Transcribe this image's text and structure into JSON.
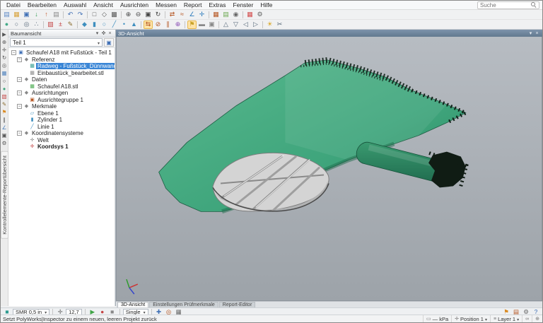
{
  "colors": {
    "selection_blue": "#3a86d6",
    "mesh_green": "#3fa57c",
    "viewport_background": "#a9aeb4",
    "highlight_orange": "#fde3a7"
  },
  "menubar": {
    "items": [
      "Datei",
      "Bearbeiten",
      "Auswahl",
      "Ansicht",
      "Ausrichten",
      "Messen",
      "Report",
      "Extras",
      "Fenster",
      "Hilfe"
    ],
    "search_placeholder": "Suche"
  },
  "toolbars": {
    "row1": [
      {
        "name": "new-project-icon",
        "glyph": "▤",
        "color": "#5b87c5"
      },
      {
        "name": "open-project-icon",
        "glyph": "▦",
        "color": "#d8a23a"
      },
      {
        "name": "save-project-icon",
        "glyph": "▣",
        "color": "#3f6fb5"
      },
      {
        "name": "import-file-icon",
        "glyph": "↓",
        "color": "#2e9b4f"
      },
      {
        "name": "export-file-icon",
        "glyph": "↑",
        "color": "#c55b2e"
      },
      {
        "name": "print-icon",
        "glyph": "▤",
        "color": "#888888"
      },
      {
        "sep": true
      },
      {
        "name": "undo-icon",
        "glyph": "↶",
        "color": "#3f6fb5"
      },
      {
        "name": "redo-icon",
        "glyph": "↷",
        "color": "#3f6fb5"
      },
      {
        "sep": true
      },
      {
        "name": "select-rectangle-icon",
        "glyph": "□",
        "color": "#555555"
      },
      {
        "name": "select-polygon-icon",
        "glyph": "◇",
        "color": "#555555"
      },
      {
        "name": "select-all-icon",
        "glyph": "▩",
        "color": "#555555"
      },
      {
        "sep": true
      },
      {
        "name": "zoom-in-icon",
        "glyph": "⊕",
        "color": "#444444"
      },
      {
        "name": "zoom-out-icon",
        "glyph": "⊖",
        "color": "#444444"
      },
      {
        "name": "fit-view-icon",
        "glyph": "▣",
        "color": "#444444"
      },
      {
        "name": "rotate-view-icon",
        "glyph": "↻",
        "color": "#444444"
      },
      {
        "sep": true
      },
      {
        "name": "align-icon",
        "glyph": "⇄",
        "color": "#b5541f"
      },
      {
        "name": "best-fit-icon",
        "glyph": "≈",
        "color": "#b5541f"
      },
      {
        "name": "measure-icon",
        "glyph": "∠",
        "color": "#2e7dbd"
      },
      {
        "name": "probe-icon",
        "glyph": "✛",
        "color": "#2e7dbd"
      },
      {
        "sep": true
      },
      {
        "name": "report-icon",
        "glyph": "▦",
        "color": "#b5541f"
      },
      {
        "name": "table-icon",
        "glyph": "▤",
        "color": "#6aa84f"
      },
      {
        "name": "snapshot-icon",
        "glyph": "◉",
        "color": "#666666"
      },
      {
        "sep": true
      },
      {
        "name": "grid-icon",
        "glyph": "▦",
        "color": "#d24b4b"
      },
      {
        "name": "options-icon",
        "glyph": "⚙",
        "color": "#666666"
      }
    ],
    "row2": [
      {
        "name": "shaded-view-icon",
        "glyph": "●",
        "color": "#44aa88"
      },
      {
        "name": "wireframe-view-icon",
        "glyph": "○",
        "color": "#556677"
      },
      {
        "name": "surface-view-icon",
        "glyph": "◎",
        "color": "#556677"
      },
      {
        "name": "points-view-icon",
        "glyph": "∴",
        "color": "#556677"
      },
      {
        "sep": true
      },
      {
        "name": "colormap-icon",
        "glyph": "▧",
        "color": "#c44545"
      },
      {
        "name": "deviation-icon",
        "glyph": "±",
        "color": "#c44545"
      },
      {
        "name": "annotation-icon",
        "glyph": "✎",
        "color": "#8a6d2f"
      },
      {
        "sep": true
      },
      {
        "name": "plane-feature-icon",
        "glyph": "◆",
        "color": "#3f8fbf"
      },
      {
        "name": "cylinder-feature-icon",
        "glyph": "▮",
        "color": "#3f8fbf"
      },
      {
        "name": "circle-feature-icon",
        "glyph": "○",
        "color": "#3f8fbf"
      },
      {
        "name": "line-feature-icon",
        "glyph": "╱",
        "color": "#3f8fbf"
      },
      {
        "name": "point-feature-icon",
        "glyph": "•",
        "color": "#3f8fbf"
      },
      {
        "name": "cone-feature-icon",
        "glyph": "▲",
        "color": "#3f8fbf"
      },
      {
        "sep": true
      },
      {
        "name": "compare-icon",
        "glyph": "⇆",
        "color": "#b5541f",
        "active": true
      },
      {
        "name": "cross-section-icon",
        "glyph": "⊘",
        "color": "#b5541f"
      },
      {
        "name": "caliper-icon",
        "glyph": "∥",
        "color": "#b5541f"
      },
      {
        "name": "gdt-icon",
        "glyph": "⊕",
        "color": "#8a4fb5"
      },
      {
        "sep": true
      },
      {
        "name": "flag-icon",
        "glyph": "⚑",
        "color": "#c9a227",
        "active": true
      },
      {
        "name": "note-icon",
        "glyph": "▬",
        "color": "#888888"
      },
      {
        "name": "camera-icon",
        "glyph": "▣",
        "color": "#888888"
      },
      {
        "sep": true
      },
      {
        "name": "view-front-icon",
        "glyph": "△",
        "color": "#556677"
      },
      {
        "name": "view-top-icon",
        "glyph": "▽",
        "color": "#556677"
      },
      {
        "name": "view-left-icon",
        "glyph": "◁",
        "color": "#556677"
      },
      {
        "name": "view-right-icon",
        "glyph": "▷",
        "color": "#556677"
      },
      {
        "sep": true
      },
      {
        "name": "light-icon",
        "glyph": "☀",
        "color": "#d9a520"
      },
      {
        "name": "clip-icon",
        "glyph": "✂",
        "color": "#556677"
      }
    ]
  },
  "side_toolbar": {
    "icons": [
      {
        "name": "select-elements-icon",
        "glyph": "▶",
        "color": "#555555"
      },
      {
        "name": "zoom-icon",
        "glyph": "⊕",
        "color": "#555555"
      },
      {
        "name": "pan-icon",
        "glyph": "✛",
        "color": "#555555"
      },
      {
        "name": "rotate-icon",
        "glyph": "↻",
        "color": "#555555"
      },
      {
        "name": "center-view-icon",
        "glyph": "◎",
        "color": "#555555"
      },
      {
        "name": "standard-views-icon",
        "glyph": "▦",
        "color": "#4a7ebb"
      },
      {
        "name": "wireframe-icon",
        "glyph": "○",
        "color": "#555555"
      },
      {
        "name": "shading-icon",
        "glyph": "●",
        "color": "#3fa57c"
      },
      {
        "name": "colormap-icon",
        "glyph": "▧",
        "color": "#c44545"
      },
      {
        "name": "annotations-icon",
        "glyph": "✎",
        "color": "#8a6d2f"
      },
      {
        "name": "flag-icon",
        "glyph": "⚑",
        "color": "#d9881f"
      },
      {
        "name": "section-icon",
        "glyph": "∥",
        "color": "#555555"
      },
      {
        "name": "measure-icon",
        "glyph": "∠",
        "color": "#4a7ebb"
      },
      {
        "name": "camera-icon",
        "glyph": "▣",
        "color": "#555555"
      },
      {
        "name": "settings-icon",
        "glyph": "⚙",
        "color": "#555555"
      }
    ],
    "vertical_tab": "Kontrollelemente-Reportübersicht"
  },
  "tree": {
    "title": "Baumansicht",
    "header_icons": [
      {
        "name": "caret-down-icon",
        "glyph": "▾"
      },
      {
        "name": "pin-icon",
        "glyph": "✜"
      },
      {
        "name": "close-icon",
        "glyph": "×"
      }
    ],
    "part_selector": "Teil 1",
    "part_button_icon": {
      "name": "part-icon",
      "glyph": "▣",
      "color": "#3f6fb5"
    },
    "items": [
      {
        "label": "Schaufel A18 mit Fußstück - Teil 1",
        "depth": 0,
        "expand": true,
        "icon": "▣",
        "icon_color": "#3f6fb5",
        "icon_name": "part-icon"
      },
      {
        "label": "Referenz",
        "depth": 1,
        "expand": true,
        "icon": "◆",
        "icon_color": "#888888",
        "icon_name": "folder-icon"
      },
      {
        "label": "Radweg - Fußstück_Dünnwandteil.stp",
        "depth": 2,
        "icon": "▦",
        "icon_color": "#2e9b8f",
        "icon_name": "cad-file-icon",
        "selected": true
      },
      {
        "label": "Einbaustück_bearbeitet.stl",
        "depth": 2,
        "icon": "▦",
        "icon_color": "#8a8a8a",
        "icon_name": "mesh-file-icon"
      },
      {
        "label": "Daten",
        "depth": 1,
        "expand": true,
        "icon": "◆",
        "icon_color": "#888888",
        "icon_name": "folder-icon"
      },
      {
        "label": "Schaufel A18.stl",
        "depth": 2,
        "icon": "▦",
        "icon_color": "#3fa546",
        "icon_name": "data-file-icon"
      },
      {
        "label": "Ausrichtungen",
        "depth": 1,
        "expand": true,
        "icon": "◆",
        "icon_color": "#888888",
        "icon_name": "folder-icon"
      },
      {
        "label": "Ausrichtegruppe 1",
        "depth": 2,
        "icon": "▣",
        "icon_color": "#b5541f",
        "icon_name": "alignment-group-icon"
      },
      {
        "label": "Merkmale",
        "depth": 1,
        "expand": true,
        "icon": "◆",
        "icon_color": "#888888",
        "icon_name": "folder-icon"
      },
      {
        "label": "Ebene 1",
        "depth": 2,
        "icon": "▱",
        "icon_color": "#3f8fbf",
        "icon_name": "plane-icon"
      },
      {
        "label": "Zylinder 1",
        "depth": 2,
        "icon": "▮",
        "icon_color": "#3f8fbf",
        "icon_name": "cylinder-icon"
      },
      {
        "label": "Linie 1",
        "depth": 2,
        "icon": "╱",
        "icon_color": "#3f8fbf",
        "icon_name": "line-icon"
      },
      {
        "label": "Koordinatensysteme",
        "depth": 1,
        "expand": true,
        "icon": "◆",
        "icon_color": "#888888",
        "icon_name": "folder-icon"
      },
      {
        "label": "Welt",
        "depth": 2,
        "icon": "✛",
        "icon_color": "#888888",
        "icon_name": "coordinate-system-icon"
      },
      {
        "label": "Koordsys 1",
        "depth": 2,
        "icon": "✛",
        "icon_color": "#c44444",
        "icon_name": "coordinate-system-icon",
        "bold": true
      }
    ]
  },
  "viewport": {
    "title": "3D-Ansicht",
    "header_icons": [
      {
        "name": "caret-down-icon",
        "glyph": "▾"
      },
      {
        "name": "close-icon",
        "glyph": "×"
      }
    ],
    "tabs": [
      "3D-Ansicht",
      "Einstellungen Prüfmerkmale",
      "Report-Editor"
    ]
  },
  "bottom_toolbar": {
    "items": [
      {
        "type": "icon",
        "name": "device-icon",
        "glyph": "■",
        "color": "#2e9b8f"
      },
      {
        "type": "select",
        "name": "device-selector",
        "label": "SMR 0,5 in"
      },
      {
        "type": "sep"
      },
      {
        "type": "icon",
        "name": "probe-size-icon",
        "glyph": "✛",
        "color": "#666666"
      },
      {
        "type": "value",
        "name": "probe-diameter-value",
        "label": "12,7"
      },
      {
        "type": "sep"
      },
      {
        "type": "icon",
        "name": "start-measure-icon",
        "glyph": "▶",
        "color": "#3fa546"
      },
      {
        "type": "icon",
        "name": "record-icon",
        "glyph": "●",
        "color": "#c44444"
      },
      {
        "type": "icon",
        "name": "stop-icon",
        "glyph": "■",
        "color": "#888888"
      },
      {
        "type": "sep"
      },
      {
        "type": "select",
        "name": "probing-mode-selector",
        "label": "Single"
      },
      {
        "type": "sep"
      },
      {
        "type": "icon",
        "name": "add-point-icon",
        "glyph": "✚",
        "color": "#3f6fb5"
      },
      {
        "type": "icon",
        "name": "target-icon",
        "glyph": "◎",
        "color": "#b5541f"
      },
      {
        "type": "icon",
        "name": "grid-icon",
        "glyph": "▦",
        "color": "#666666"
      }
    ],
    "right_icons": [
      {
        "name": "warning-flag-icon",
        "glyph": "⚑",
        "color": "#d9881f"
      },
      {
        "name": "macro-icon",
        "glyph": "▤",
        "color": "#b5541f"
      },
      {
        "name": "settings-icon",
        "glyph": "⚙",
        "color": "#666666"
      },
      {
        "name": "help-icon",
        "glyph": "?",
        "color": "#3f6fb5"
      }
    ]
  },
  "statusbar": {
    "message": "Setzt PolyWorks|Inspector zu einem neuen, leeren Projekt zurück",
    "items": [
      {
        "name": "units-indicator",
        "glyph": "▭",
        "glyph_color": "#777777",
        "label": "—  kPa",
        "caret": false
      },
      {
        "name": "position-indicator",
        "glyph": "✛",
        "glyph_color": "#777777",
        "label": "Position 1",
        "caret": true
      },
      {
        "name": "layer-indicator",
        "glyph": "≡",
        "glyph_color": "#777777",
        "label": "Layer 1",
        "caret": true
      },
      {
        "name": "sync-indicator",
        "glyph": "∞",
        "glyph_color": "#777777",
        "label": "",
        "caret": false
      },
      {
        "name": "zoom-indicator",
        "glyph": "⊕",
        "glyph_color": "#777777",
        "label": "",
        "caret": false
      }
    ]
  }
}
